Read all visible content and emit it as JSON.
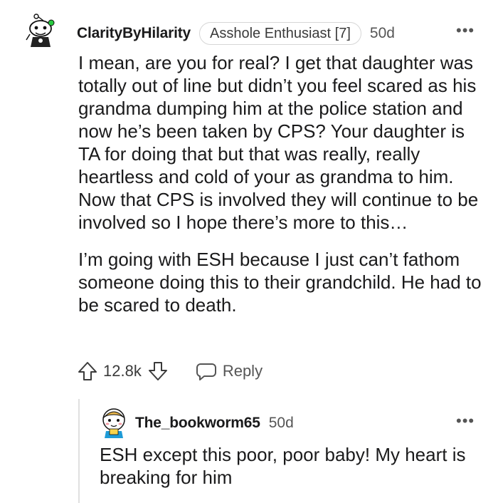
{
  "comment": {
    "username": "ClarityByHilarity",
    "flair": "Asshole Enthusiast [7]",
    "time": "50d",
    "more_label": "•••",
    "paragraphs": [
      "I mean, are you for real? I get that daughter was totally out of line but didn’t you feel scared as his grandma dumping him at the police station and now he’s been taken by CPS? Your daughter is TA for doing that but that was really, really heartless and cold of your as grandma to him. Now that CPS is involved they will continue to be involved so I hope there’s more to this…",
      "I’m going with ESH because I just can’t fathom someone doing this to their grandchild. He had to be scared to death."
    ],
    "score": "12.8k",
    "reply_label": "Reply"
  },
  "reply": {
    "username": "The_bookworm65",
    "time": "50d",
    "more_label": "•••",
    "text": "ESH except this poor, poor baby! My heart is breaking for him"
  },
  "icons": {
    "upvote": "arrow-up-icon",
    "downvote": "arrow-down-icon",
    "reply": "speech-bubble-icon",
    "more": "ellipsis-icon"
  }
}
